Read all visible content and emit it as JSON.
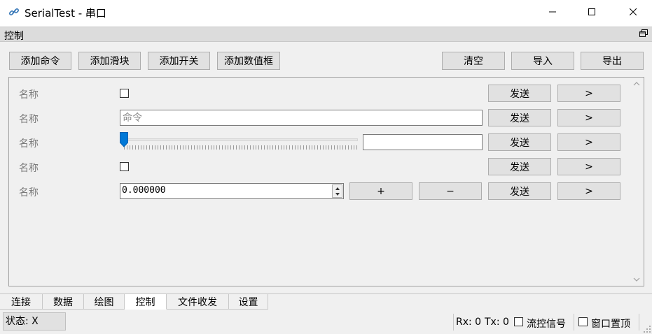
{
  "window": {
    "title": "SerialTest - 串口",
    "app_icon": "link-icon",
    "minimize": "–",
    "maximize": "☐",
    "close": "✕"
  },
  "dock": {
    "title": "控制"
  },
  "toolbar": {
    "add_command": "添加命令",
    "add_slider": "添加滑块",
    "add_switch": "添加开关",
    "add_numeric": "添加数值框",
    "clear": "清空",
    "import": "导入",
    "export": "导出"
  },
  "rows": [
    {
      "name": "名称",
      "type": "checkbox",
      "checked": false,
      "send": "发送",
      "more": ">"
    },
    {
      "name": "名称",
      "type": "command",
      "placeholder": "命令",
      "value": "",
      "send": "发送",
      "more": ">"
    },
    {
      "name": "名称",
      "type": "slider",
      "slider_value": 0,
      "value": "",
      "send": "发送",
      "more": ">"
    },
    {
      "name": "名称",
      "type": "checkbox",
      "checked": false,
      "send": "发送",
      "more": ">"
    },
    {
      "name": "名称",
      "type": "numeric",
      "value": "0.000000",
      "plus": "+",
      "minus": "−",
      "send": "发送",
      "more": ">"
    }
  ],
  "tabs": [
    {
      "label": "连接",
      "active": false
    },
    {
      "label": "数据",
      "active": false
    },
    {
      "label": "绘图",
      "active": false
    },
    {
      "label": "控制",
      "active": true
    },
    {
      "label": "文件收发",
      "active": false
    },
    {
      "label": "设置",
      "active": false
    }
  ],
  "status": {
    "state": "状态: X",
    "rx": "Rx: 0",
    "tx": "Tx: 0",
    "flow_control": "流控信号",
    "flow_control_checked": false,
    "always_on_top": "窗口置顶",
    "always_on_top_checked": false
  },
  "colors": {
    "accent": "#0078d7",
    "button_bg": "#e1e1e1",
    "panel_bg": "#f0f0f0"
  }
}
